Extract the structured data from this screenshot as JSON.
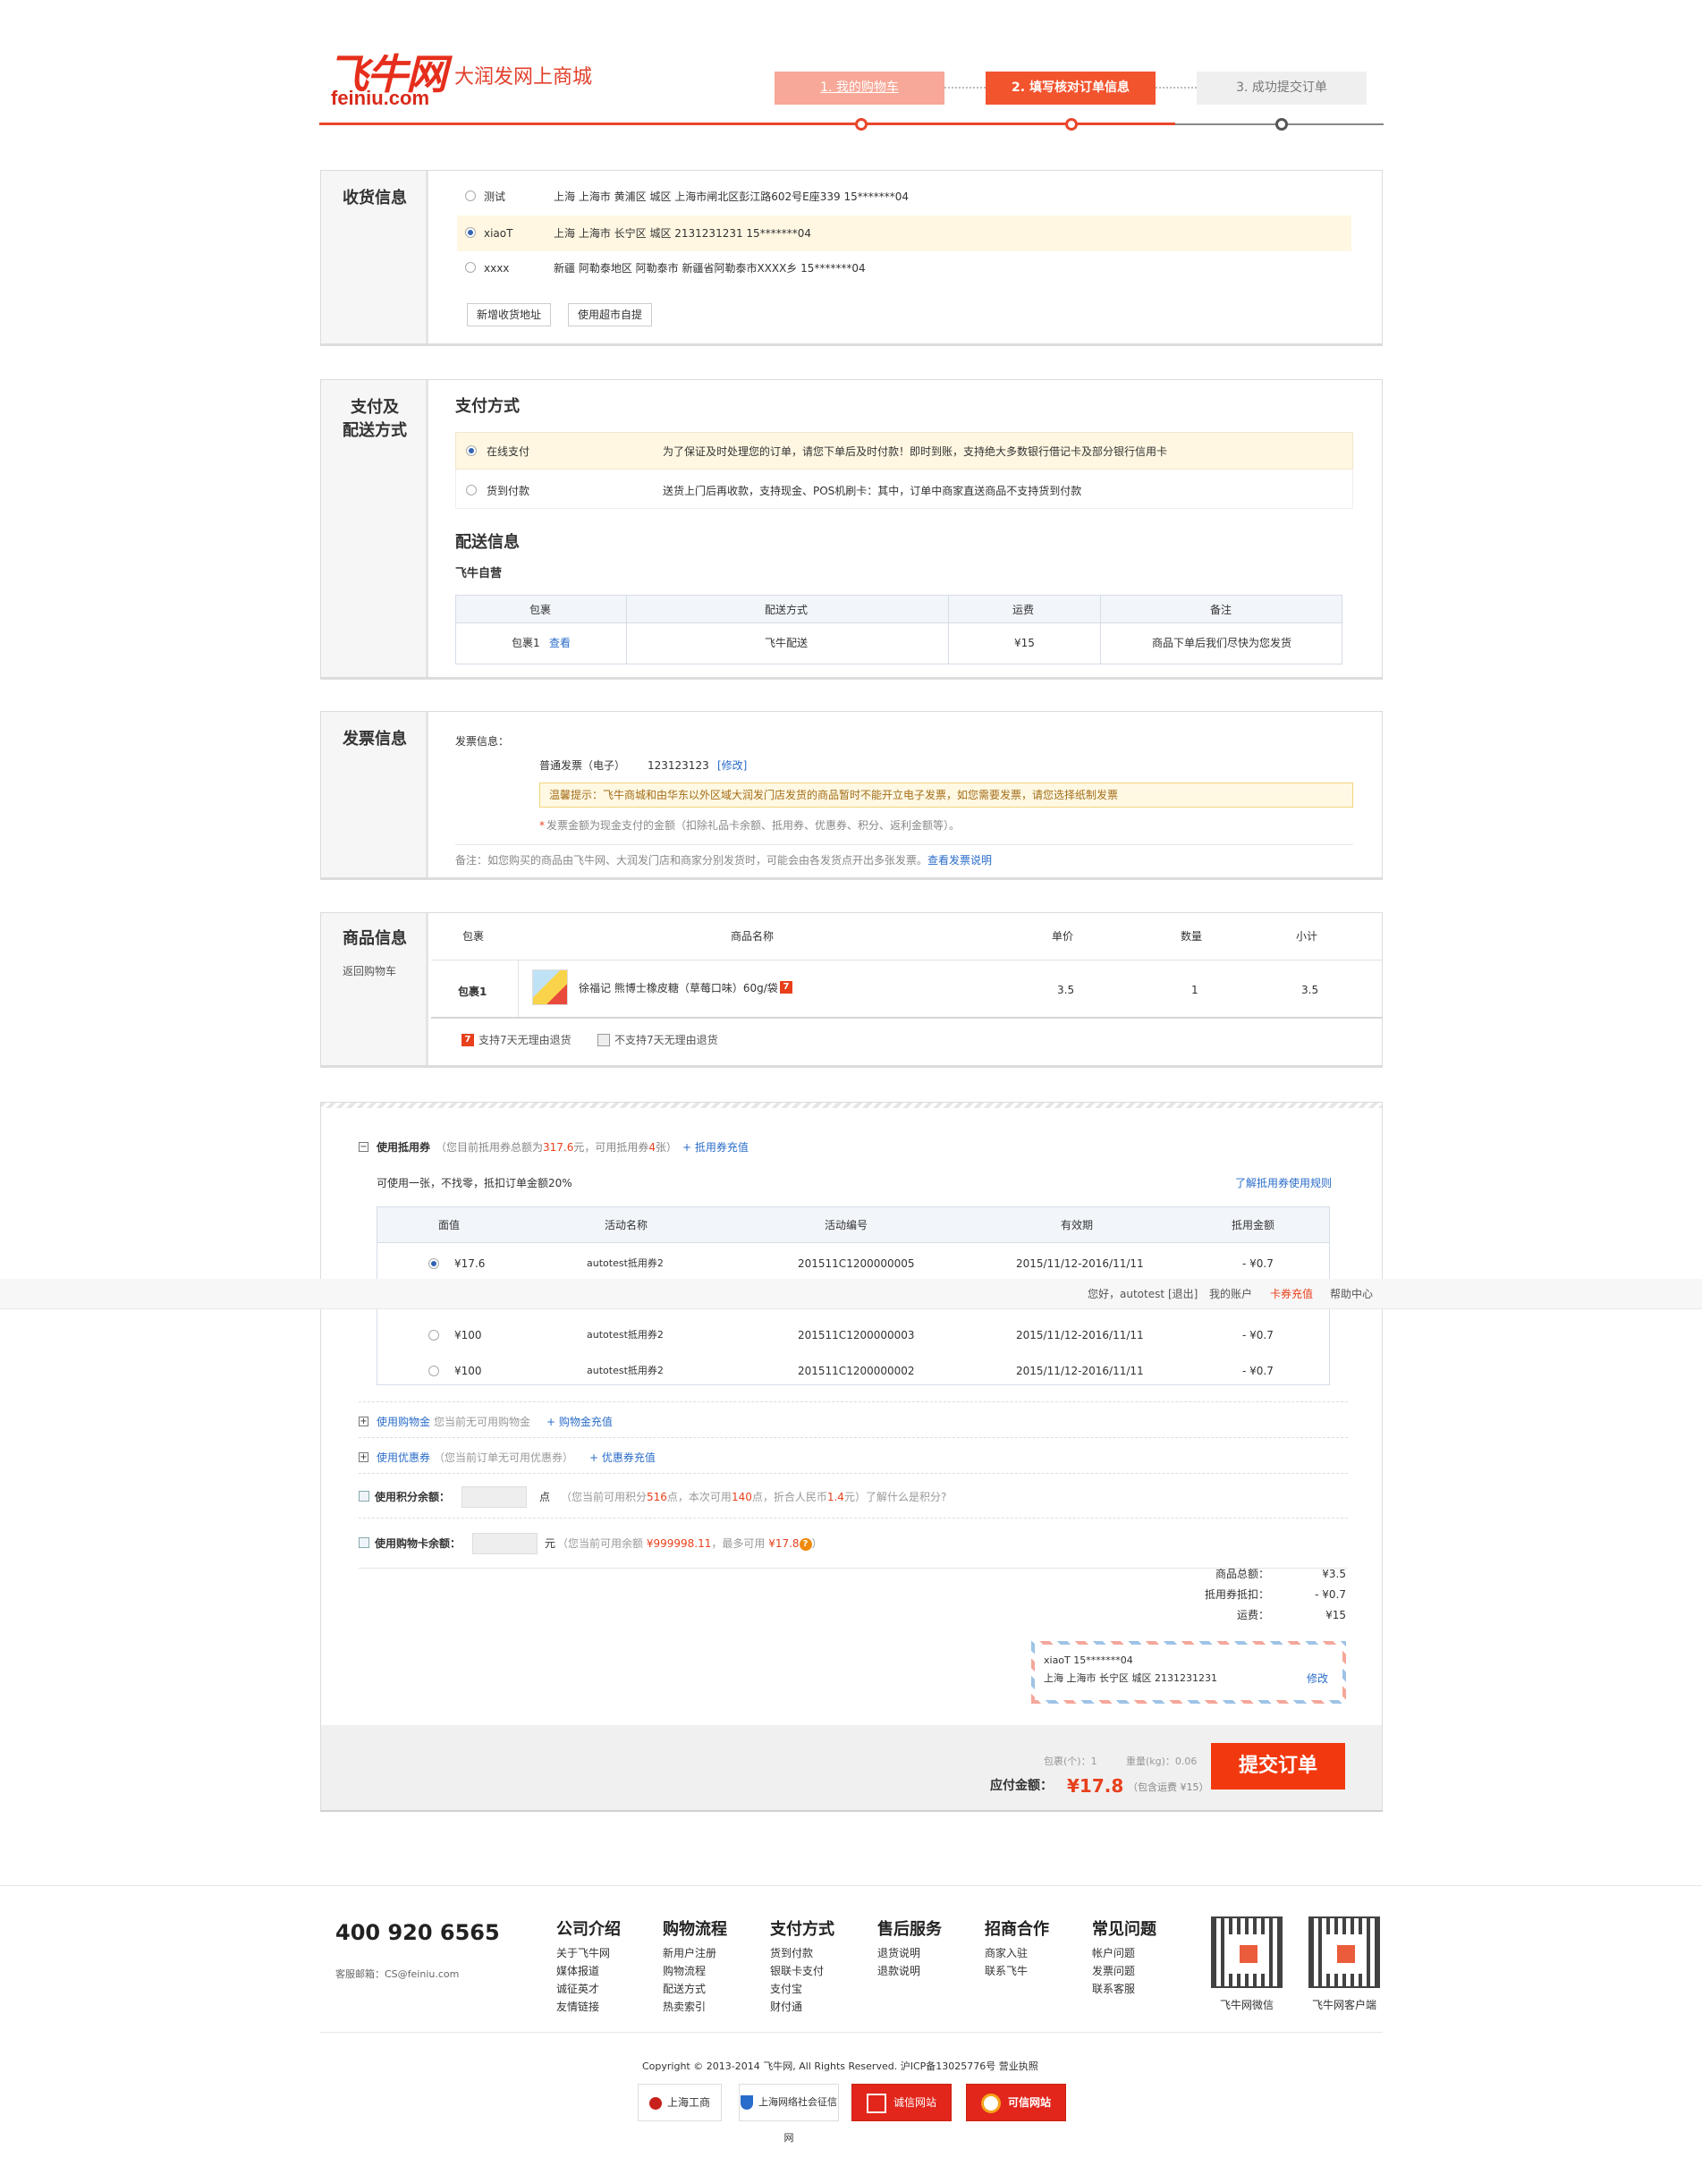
{
  "header": {
    "logo_text": "飞牛网",
    "logo_domain": "feiniu.com",
    "slogan": "大润发网上商城",
    "steps": [
      "1. 我的购物车",
      "2. 填写核对订单信息",
      "3. 成功提交订单"
    ]
  },
  "address": {
    "title": "收货信息",
    "items": [
      {
        "name": "测试",
        "detail": "上海  上海市  黄浦区  城区  上海市闸北区彭江路602号E座339  15*******04",
        "selected": false
      },
      {
        "name": "xiaoT",
        "detail": "上海  上海市  长宁区  城区  2131231231  15*******04",
        "selected": true
      },
      {
        "name": "xxxx",
        "detail": "新疆  阿勒泰地区  阿勒泰市  新疆省阿勒泰市XXXX乡  15*******04",
        "selected": false
      }
    ],
    "add_button": "新增收货地址",
    "pickup_button": "使用超市自提"
  },
  "payment": {
    "title_line1": "支付及",
    "title_line2": "配送方式",
    "pay_heading": "支付方式",
    "methods": [
      {
        "label": "在线支付",
        "desc": "为了保证及时处理您的订单，请您下单后及时付款！即时到账，支持绝大多数银行借记卡及部分银行信用卡",
        "selected": true
      },
      {
        "label": "货到付款",
        "desc": "送货上门后再收款，支持现金、POS机刷卡：其中，订单中商家直送商品不支持货到付款",
        "selected": false
      }
    ],
    "delivery_heading": "配送信息",
    "seller": "飞牛自营",
    "delivery_table": {
      "headers": [
        "包裹",
        "配送方式",
        "运费",
        "备注"
      ],
      "row": {
        "package": "包裹1",
        "view_link": "查看",
        "method": "飞牛配送",
        "fee": "¥15",
        "note": "商品下单后我们尽快为您发货"
      }
    }
  },
  "invoice": {
    "title": "发票信息",
    "label": "发票信息：",
    "type": "普通发票（电子）",
    "number": "123123123",
    "edit": "[修改]",
    "tip": "温馨提示：飞牛商城和由华东以外区域大润发门店发货的商品暂时不能开立电子发票，如您需要发票，请您选择纸制发票",
    "amount_note_star": "*",
    "amount_note": "发票金额为现金支付的金额（扣除礼品卡余额、抵用券、优惠券、积分、返利金额等）。",
    "remark": "备注：如您购买的商品由飞牛网、大润发门店和商家分别发货时，可能会由各发货点开出多张发票。",
    "remark_link": "查看发票说明"
  },
  "products": {
    "title": "商品信息",
    "back_link": "返回购物车",
    "headers": [
      "包裹",
      "商品名称",
      "单价",
      "数量",
      "小计"
    ],
    "row": {
      "package": "包裹1",
      "name": "徐福记 熊博士橡皮糖（草莓口味）60g/袋",
      "tag": "7",
      "price": "3.5",
      "qty": "1",
      "subtotal": "3.5"
    },
    "legend_yes": "支持7天无理由退货",
    "legend_no": "不支持7天无理由退货"
  },
  "coupons": {
    "heading": "使用抵用券",
    "summary_prefix": "（您目前抵用券总额为",
    "summary_total": "317.6",
    "summary_mid": "元，可用抵用券",
    "summary_count": "4",
    "summary_suffix": "张）",
    "recharge": "+ 抵用券充值",
    "rule": "可使用一张，不找零，抵扣订单金额20%",
    "rule_link": "了解抵用券使用规则",
    "headers": [
      "面值",
      "活动名称",
      "活动编号",
      "有效期",
      "抵用金额"
    ],
    "rows": [
      {
        "value": "¥17.6",
        "name": "autotest抵用券2",
        "code": "201511C1200000005",
        "period": "2015/11/12-2016/11/11",
        "amount": "- ¥0.7",
        "selected": true
      },
      {
        "value": "¥100",
        "name": "autotest抵用券2",
        "code": "201511C1200000003",
        "period": "2015/11/12-2016/11/11",
        "amount": "- ¥0.7",
        "selected": false
      },
      {
        "value": "¥100",
        "name": "autotest抵用券2",
        "code": "201511C1200000002",
        "period": "2015/11/12-2016/11/11",
        "amount": "- ¥0.7",
        "selected": false
      }
    ]
  },
  "topbar": {
    "greeting": "您好，autotest",
    "logout": "[退出]",
    "account": "我的账户",
    "recharge": "卡券充值",
    "help": "帮助中心"
  },
  "shopping_money": {
    "label": "使用购物金",
    "note": "您当前无可用购物金",
    "link": "+ 购物金充值"
  },
  "discount": {
    "label": "使用优惠券",
    "note": "（您当前订单无可用优惠券）",
    "link": "+ 优惠券充值"
  },
  "points": {
    "label": "使用积分余额：",
    "unit": "点",
    "note_a": "（您当前可用积分",
    "avail": "516",
    "note_b": "点，本次可用",
    "usable": "140",
    "note_c": "点，折合人民币",
    "rmb": "1.4",
    "note_d": "元）了解什么是积分?"
  },
  "giftcard": {
    "label": "使用购物卡余额：",
    "unit": "元",
    "note_a": "（您当前可用余额 ",
    "balance": "¥999998.11",
    "note_b": "，最多可用 ",
    "max": "¥17.8",
    "note_c": "）"
  },
  "totals": [
    {
      "label": "商品总额：",
      "value": "¥3.5"
    },
    {
      "label": "抵用券抵扣：",
      "value": "- ¥0.7"
    },
    {
      "label": "运费：",
      "value": "¥15"
    }
  ],
  "ship_card": {
    "line1": "xiaoT  15*******04",
    "line2": "上海 上海市 长宁区 城区 2131231231",
    "edit": "修改"
  },
  "submit_bar": {
    "packages": "包裹(个)：1",
    "weight": "重量(kg)：0.06",
    "payable_label": "应付金额：",
    "payable": "¥17.8",
    "incl": "（包含运费 ¥15）",
    "submit": "提交订单"
  },
  "footer": {
    "phone": "400 920 6565",
    "email": "客服邮箱：CS@feiniu.com",
    "columns": [
      {
        "title": "公司介绍",
        "items": [
          "关于飞牛网",
          "媒体报道",
          "诚征英才",
          "友情链接"
        ]
      },
      {
        "title": "购物流程",
        "items": [
          "新用户注册",
          "购物流程",
          "配送方式",
          "热卖索引"
        ]
      },
      {
        "title": "支付方式",
        "items": [
          "货到付款",
          "银联卡支付",
          "支付宝",
          "财付通"
        ]
      },
      {
        "title": "售后服务",
        "items": [
          "退货说明",
          "退款说明"
        ]
      },
      {
        "title": "招商合作",
        "items": [
          "商家入驻",
          "联系飞牛"
        ]
      },
      {
        "title": "常见问题",
        "items": [
          "帐户问题",
          "发票问题",
          "联系客服"
        ]
      }
    ],
    "qr1": "飞牛网微信",
    "qr2": "飞牛网客户端",
    "copyright": "Copyright © 2013-2014 飞牛网, All Rights Reserved. 沪ICP备13025776号 营业执照",
    "badges": [
      "上海工商",
      "上海网络社会征信网",
      "诚信网站",
      "可信网站"
    ]
  },
  "colors": {
    "accent": "#e9462b",
    "submit": "#f2380e",
    "link": "#2a6cc9",
    "highlight": "#fff7e2"
  }
}
